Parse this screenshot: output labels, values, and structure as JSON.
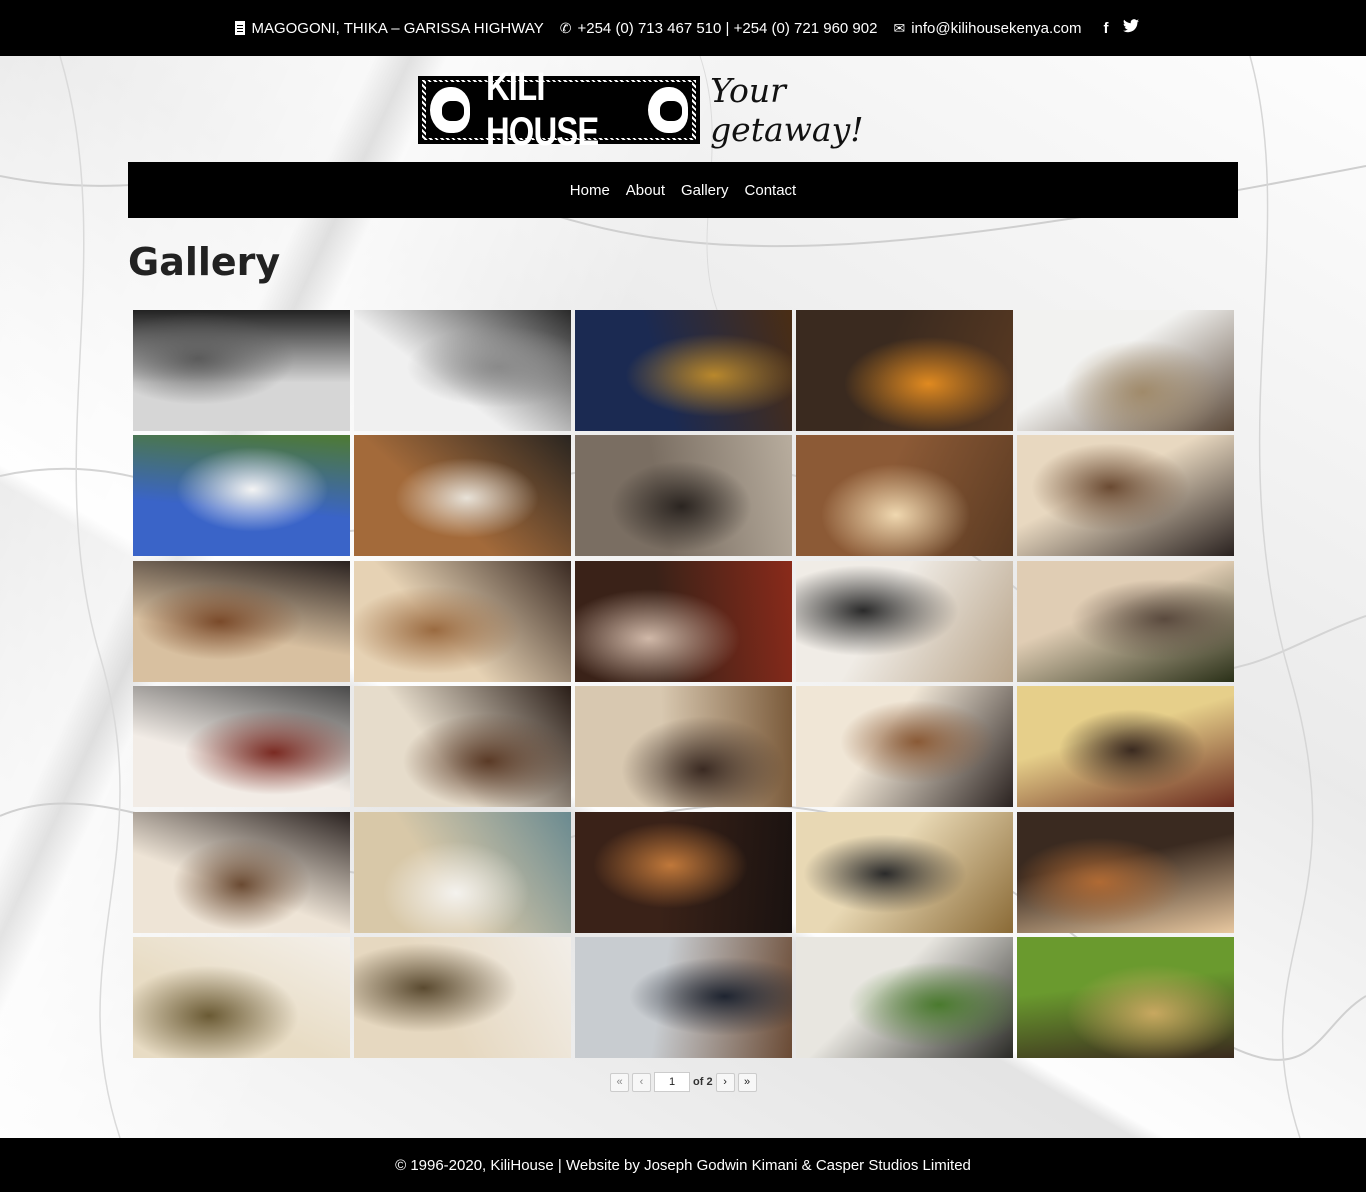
{
  "topbar": {
    "address": "MAGOGONI, THIKA – GARISSA HIGHWAY",
    "phone": "+254 (0) 713 467 510 | +254 (0) 721 960 902",
    "email": "info@kilihousekenya.com",
    "facebook_glyph": "f",
    "twitter_glyph": "🐦"
  },
  "logo": {
    "text": "KILI HOUSE",
    "tagline": "Your getaway!"
  },
  "nav": {
    "items": [
      "Home",
      "About",
      "Gallery",
      "Contact"
    ]
  },
  "page": {
    "title": "Gallery"
  },
  "gallery": {
    "thumbs": [
      {
        "name": "sign",
        "c1": "#d6d6d6",
        "c2": "#5b5b5b",
        "c3": "#222222"
      },
      {
        "name": "house-bw",
        "c1": "#f0f0f0",
        "c2": "#8a8a8a",
        "c3": "#2a2a2a"
      },
      {
        "name": "house-night",
        "c1": "#1b2a52",
        "c2": "#b9882c",
        "c3": "#4a2d14"
      },
      {
        "name": "flower",
        "c1": "#3a2a1f",
        "c2": "#e08a20",
        "c3": "#5a3a22"
      },
      {
        "name": "courtyard",
        "c1": "#f2f2f0",
        "c2": "#a08a6a",
        "c3": "#5c4a3a"
      },
      {
        "name": "house-day",
        "c1": "#3a64c8",
        "c2": "#f4f4f4",
        "c3": "#4e7a32"
      },
      {
        "name": "coffee-table",
        "c1": "#a36a3a",
        "c2": "#e8e2d8",
        "c3": "#2a2520"
      },
      {
        "name": "beer-barrel",
        "c1": "#7a6e62",
        "c2": "#2a2420",
        "c3": "#b8ad9e"
      },
      {
        "name": "bar-arch",
        "c1": "#8c5a36",
        "c2": "#f0d8b0",
        "c3": "#5a3a22"
      },
      {
        "name": "bar-people",
        "c1": "#e8d8c0",
        "c2": "#6a4a32",
        "c3": "#2a2220"
      },
      {
        "name": "bar-guests",
        "c1": "#d8c0a0",
        "c2": "#7a4a2a",
        "c3": "#2a2220"
      },
      {
        "name": "bar-counter",
        "c1": "#e6d2b4",
        "c2": "#9a6a40",
        "c3": "#3a2a22"
      },
      {
        "name": "wall-masks",
        "c1": "#3a2218",
        "c2": "#d0b8a8",
        "c3": "#8a2a1a"
      },
      {
        "name": "chandelier",
        "c1": "#f0ece6",
        "c2": "#2a2a2a",
        "c3": "#b8a48a"
      },
      {
        "name": "lounge",
        "c1": "#e0cdb4",
        "c2": "#5a4a3e",
        "c3": "#2a3018"
      },
      {
        "name": "red-wall",
        "c1": "#f2ece6",
        "c2": "#7a2a22",
        "c3": "#4a4a4a"
      },
      {
        "name": "staircase",
        "c1": "#e6dccb",
        "c2": "#5a3a26",
        "c3": "#2a1e18"
      },
      {
        "name": "hall",
        "c1": "#d8c8b0",
        "c2": "#3a2a22",
        "c3": "#7a5a3a"
      },
      {
        "name": "piano",
        "c1": "#f0e6d6",
        "c2": "#8a5a36",
        "c3": "#2a2220"
      },
      {
        "name": "dining",
        "c1": "#e6cf8a",
        "c2": "#3a2a20",
        "c3": "#6a2a1e"
      },
      {
        "name": "bar-cats",
        "c1": "#eee4d6",
        "c2": "#6a4a32",
        "c3": "#2a2220"
      },
      {
        "name": "sink",
        "c1": "#d8c8a8",
        "c2": "#f4f2ee",
        "c3": "#6a8a90"
      },
      {
        "name": "living-night",
        "c1": "#3a2218",
        "c2": "#c0783a",
        "c3": "#1a1210"
      },
      {
        "name": "tv-room",
        "c1": "#e8d8b4",
        "c2": "#2a2a2a",
        "c3": "#8a6a36"
      },
      {
        "name": "stairs-bike",
        "c1": "#3a2a20",
        "c2": "#b06a34",
        "c3": "#e8c8a0"
      },
      {
        "name": "bedroom1",
        "c1": "#e8dcc4",
        "c2": "#6a5a34",
        "c3": "#f4f0ea"
      },
      {
        "name": "bedroom2",
        "c1": "#e6d8c0",
        "c2": "#5a4a30",
        "c3": "#f2eee8"
      },
      {
        "name": "balcony",
        "c1": "#c8ccd0",
        "c2": "#1e2430",
        "c3": "#6a4a34"
      },
      {
        "name": "umbrella",
        "c1": "#e8e6e0",
        "c2": "#4a7a2e",
        "c3": "#2a2a26"
      },
      {
        "name": "garden",
        "c1": "#6a9a2e",
        "c2": "#c8a860",
        "c3": "#3a2a1e"
      }
    ]
  },
  "pager": {
    "first": "«",
    "prev": "‹",
    "current": "1",
    "of_text": "of 2",
    "next": "›",
    "last": "»"
  },
  "footer": {
    "text": "© 1996-2020, KiliHouse | Website by Joseph Godwin Kimani & Casper Studios Limited"
  }
}
